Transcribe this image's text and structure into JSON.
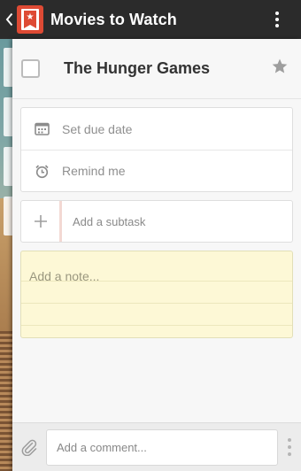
{
  "toolbar": {
    "title": "Movies to Watch",
    "app_logo_glyph": "★"
  },
  "task": {
    "title": "The Hunger Games",
    "completed": false,
    "starred": false
  },
  "meta": {
    "due_date_label": "Set due date",
    "remind_label": "Remind me"
  },
  "subtask": {
    "placeholder": "Add a subtask"
  },
  "note": {
    "placeholder": "Add a note..."
  },
  "comment": {
    "placeholder": "Add a comment..."
  },
  "icons": {
    "back": "chevron-left-icon",
    "overflow": "more-vertical-icon",
    "star": "star-icon",
    "calendar": "calendar-icon",
    "alarm": "alarm-clock-icon",
    "plus": "plus-icon",
    "attach": "paperclip-icon",
    "more": "more-vertical-icon"
  },
  "colors": {
    "accent": "#de4a34",
    "toolbar": "#2b2b2b",
    "note_bg": "#fdf8d6"
  }
}
